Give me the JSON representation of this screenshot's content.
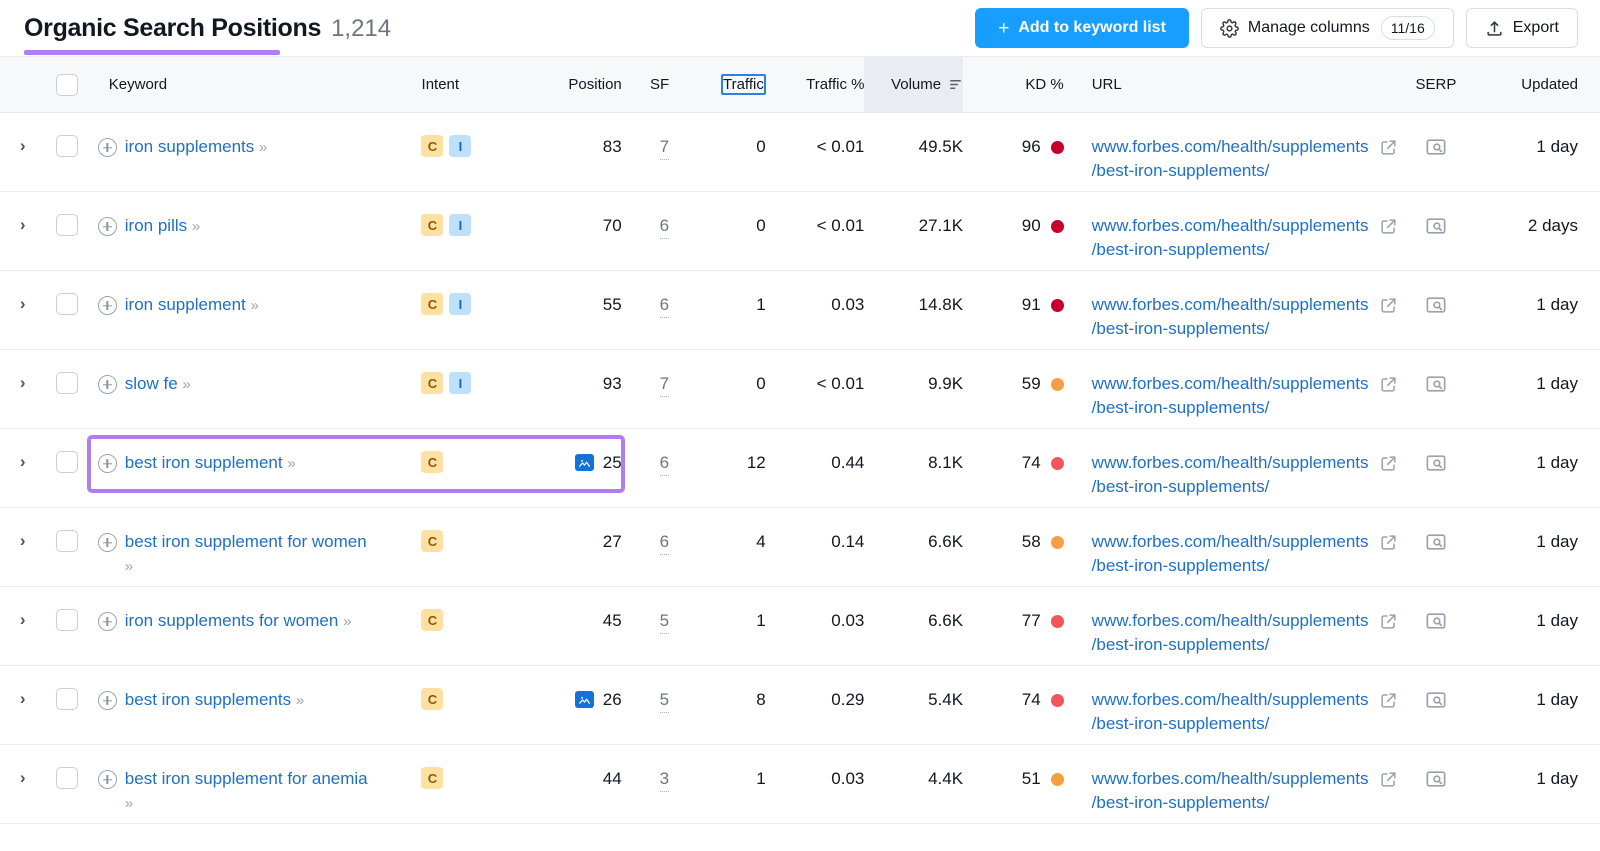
{
  "header": {
    "title": "Organic Search Positions",
    "count": "1,214",
    "accent_color": "#b07ef0",
    "add_to_keyword_list": "Add to keyword list",
    "add_icon": "plus-icon",
    "manage_columns": "Manage columns",
    "manage_columns_count": "11/16",
    "manage_columns_icon": "gear-icon",
    "export": "Export",
    "export_icon": "upload-icon",
    "primary_color": "#189eff"
  },
  "columns": {
    "keyword": "Keyword",
    "intent": "Intent",
    "position": "Position",
    "sf": "SF",
    "traffic": "Traffic",
    "traffic_pct": "Traffic %",
    "volume": "Volume",
    "kd": "KD %",
    "url": "URL",
    "serp": "SERP",
    "updated": "Updated",
    "sort_column": "Volume",
    "sort_direction": "desc",
    "focused_column": "Traffic"
  },
  "rows": [
    {
      "keyword": "iron supplements",
      "intents": [
        "C",
        "I"
      ],
      "position": "83",
      "position_feature": false,
      "sf": "7",
      "traffic": "0",
      "traffic_pct": "< 0.01",
      "volume": "49.5K",
      "kd": "96",
      "kd_color": "#c4002b",
      "url": "www.forbes.com/health/supplements/best-iron-supplements/",
      "updated": "1 day",
      "highlighted": false
    },
    {
      "keyword": "iron pills",
      "intents": [
        "C",
        "I"
      ],
      "position": "70",
      "position_feature": false,
      "sf": "6",
      "traffic": "0",
      "traffic_pct": "< 0.01",
      "volume": "27.1K",
      "kd": "90",
      "kd_color": "#c4002b",
      "url": "www.forbes.com/health/supplements/best-iron-supplements/",
      "updated": "2 days",
      "highlighted": false
    },
    {
      "keyword": "iron supplement",
      "intents": [
        "C",
        "I"
      ],
      "position": "55",
      "position_feature": false,
      "sf": "6",
      "traffic": "1",
      "traffic_pct": "0.03",
      "volume": "14.8K",
      "kd": "91",
      "kd_color": "#c4002b",
      "url": "www.forbes.com/health/supplements/best-iron-supplements/",
      "updated": "1 day",
      "highlighted": false
    },
    {
      "keyword": "slow fe",
      "intents": [
        "C",
        "I"
      ],
      "position": "93",
      "position_feature": false,
      "sf": "7",
      "traffic": "0",
      "traffic_pct": "< 0.01",
      "volume": "9.9K",
      "kd": "59",
      "kd_color": "#f5a040",
      "url": "www.forbes.com/health/supplements/best-iron-supplements/",
      "updated": "1 day",
      "highlighted": false
    },
    {
      "keyword": "best iron supplement",
      "intents": [
        "C"
      ],
      "position": "25",
      "position_feature": true,
      "position_feature_icon": "image-serp-feature-icon",
      "sf": "6",
      "traffic": "12",
      "traffic_pct": "0.44",
      "volume": "8.1K",
      "kd": "74",
      "kd_color": "#f2555a",
      "url": "www.forbes.com/health/supplements/best-iron-supplements/",
      "updated": "1 day",
      "highlighted": true
    },
    {
      "keyword": "best iron supplement for women",
      "intents": [
        "C"
      ],
      "position": "27",
      "position_feature": false,
      "sf": "6",
      "traffic": "4",
      "traffic_pct": "0.14",
      "volume": "6.6K",
      "kd": "58",
      "kd_color": "#f5a040",
      "url": "www.forbes.com/health/supplements/best-iron-supplements/",
      "updated": "1 day",
      "highlighted": false
    },
    {
      "keyword": "iron supplements for women",
      "intents": [
        "C"
      ],
      "position": "45",
      "position_feature": false,
      "sf": "5",
      "traffic": "1",
      "traffic_pct": "0.03",
      "volume": "6.6K",
      "kd": "77",
      "kd_color": "#f2555a",
      "url": "www.forbes.com/health/supplements/best-iron-supplements/",
      "updated": "1 day",
      "highlighted": false
    },
    {
      "keyword": "best iron supplements",
      "intents": [
        "C"
      ],
      "position": "26",
      "position_feature": true,
      "position_feature_icon": "image-serp-feature-icon",
      "sf": "5",
      "traffic": "8",
      "traffic_pct": "0.29",
      "volume": "5.4K",
      "kd": "74",
      "kd_color": "#f2555a",
      "url": "www.forbes.com/health/supplements/best-iron-supplements/",
      "updated": "1 day",
      "highlighted": false
    },
    {
      "keyword": "best iron supplement for anemia",
      "intents": [
        "C"
      ],
      "position": "44",
      "position_feature": false,
      "sf": "3",
      "traffic": "1",
      "traffic_pct": "0.03",
      "volume": "4.4K",
      "kd": "51",
      "kd_color": "#f5a040",
      "url": "www.forbes.com/health/supplements/best-iron-supplements/",
      "updated": "1 day",
      "highlighted": false
    }
  ]
}
